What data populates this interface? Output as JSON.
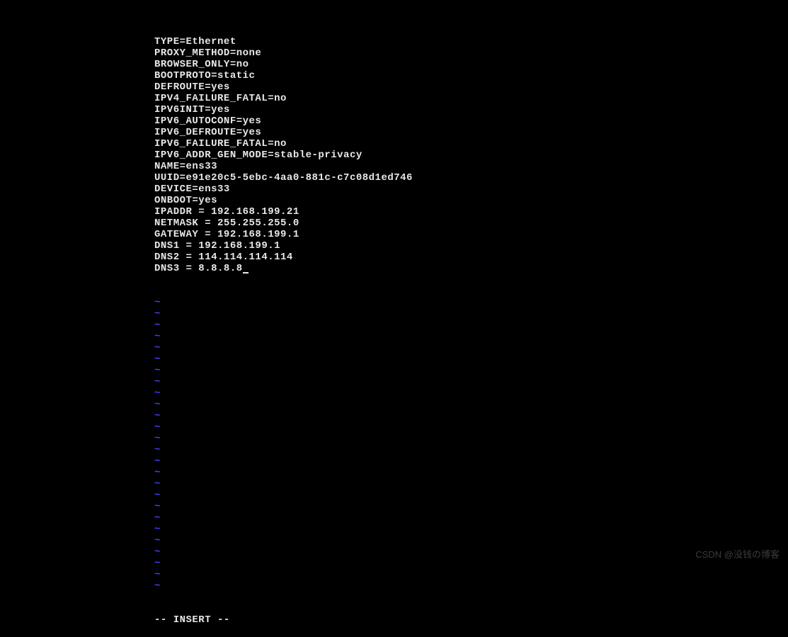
{
  "editor": {
    "config_lines": [
      "TYPE=Ethernet",
      "PROXY_METHOD=none",
      "BROWSER_ONLY=no",
      "BOOTPROTO=static",
      "DEFROUTE=yes",
      "IPV4_FAILURE_FATAL=no",
      "IPV6INIT=yes",
      "IPV6_AUTOCONF=yes",
      "IPV6_DEFROUTE=yes",
      "IPV6_FAILURE_FATAL=no",
      "IPV6_ADDR_GEN_MODE=stable-privacy",
      "NAME=ens33",
      "UUID=e91e20c5-5ebc-4aa0-881c-c7c08d1ed746",
      "DEVICE=ens33",
      "ONBOOT=yes",
      "IPADDR = 192.168.199.21",
      "NETMASK = 255.255.255.0",
      "GATEWAY = 192.168.199.1",
      "DNS1 = 192.168.199.1",
      "DNS2 = 114.114.114.114",
      "DNS3 = 8.8.8.8"
    ],
    "tilde_char": "~",
    "tilde_count": 26,
    "status_text": "-- INSERT --"
  },
  "watermark": "CSDN @没钱の博客"
}
